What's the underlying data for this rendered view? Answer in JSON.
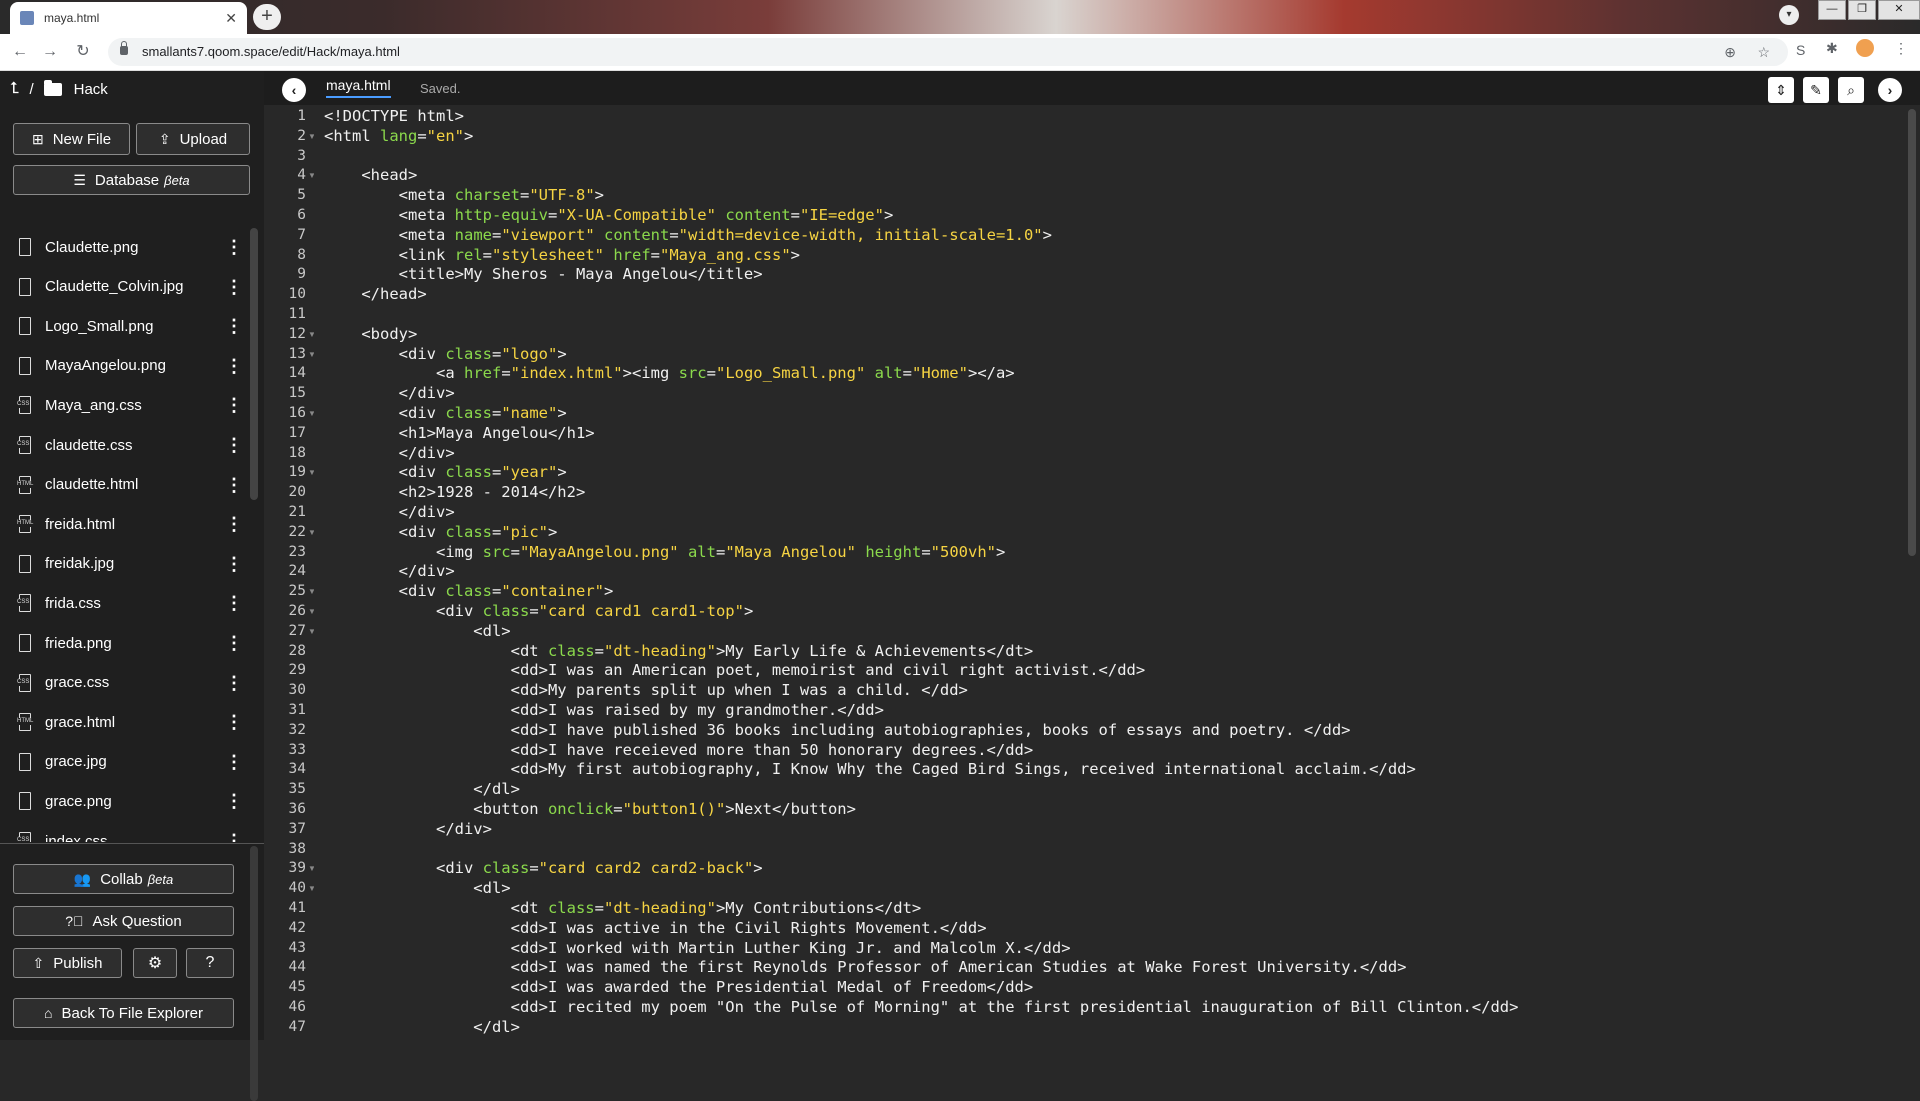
{
  "browser": {
    "tab_title": "maya.html",
    "url": "smallants7.qoom.space/edit/Hack/maya.html"
  },
  "sidebar": {
    "breadcrumb_folder": "Hack",
    "new_file_label": "New File",
    "upload_label": "Upload",
    "database_label": "Database",
    "database_beta": "βeta",
    "files": [
      {
        "name": "Claudette.png",
        "type": "file"
      },
      {
        "name": "Claudette_Colvin.jpg",
        "type": "file"
      },
      {
        "name": "Logo_Small.png",
        "type": "file"
      },
      {
        "name": "MayaAngelou.png",
        "type": "file"
      },
      {
        "name": "Maya_ang.css",
        "type": "css"
      },
      {
        "name": "claudette.css",
        "type": "css"
      },
      {
        "name": "claudette.html",
        "type": "html"
      },
      {
        "name": "freida.html",
        "type": "html"
      },
      {
        "name": "freidak.jpg",
        "type": "file"
      },
      {
        "name": "frida.css",
        "type": "css"
      },
      {
        "name": "frieda.png",
        "type": "file"
      },
      {
        "name": "grace.css",
        "type": "css"
      },
      {
        "name": "grace.html",
        "type": "html"
      },
      {
        "name": "grace.jpg",
        "type": "file"
      },
      {
        "name": "grace.png",
        "type": "file"
      },
      {
        "name": "index.css",
        "type": "css"
      }
    ],
    "collab_label": "Collab",
    "collab_beta": "βeta",
    "ask_label": "Ask Question",
    "publish_label": "Publish",
    "back_label": "Back To File Explorer"
  },
  "editor": {
    "tab_name": "maya.html",
    "status": "Saved.",
    "lines": [
      "<!DOCTYPE html>",
      "<html lang=\"en\">",
      "",
      "    <head>",
      "        <meta charset=\"UTF-8\">",
      "        <meta http-equiv=\"X-UA-Compatible\" content=\"IE=edge\">",
      "        <meta name=\"viewport\" content=\"width=device-width, initial-scale=1.0\">",
      "        <link rel=\"stylesheet\" href=\"Maya_ang.css\">",
      "        <title>My Sheros - Maya Angelou</title>",
      "    </head>",
      "",
      "    <body>",
      "        <div class=\"logo\">",
      "            <a href=\"index.html\"><img src=\"Logo_Small.png\" alt=\"Home\"></a>",
      "        </div>",
      "        <div class=\"name\">",
      "        <h1>Maya Angelou</h1>",
      "        </div>",
      "        <div class=\"year\">",
      "        <h2>1928 - 2014</h2>",
      "        </div>",
      "        <div class=\"pic\">",
      "            <img src=\"MayaAngelou.png\" alt=\"Maya Angelou\" height=\"500vh\">",
      "        </div>",
      "        <div class=\"container\">",
      "            <div class=\"card card1 card1-top\">",
      "                <dl>",
      "                    <dt class=\"dt-heading\">My Early Life & Achievements</dt>",
      "                    <dd>I was an American poet, memoirist and civil right activist.</dd>",
      "                    <dd>My parents split up when I was a child. </dd>",
      "                    <dd>I was raised by my grandmother.</dd>",
      "                    <dd>I have published 36 books including autobiographies, books of essays and poetry. </dd>",
      "                    <dd>I have receieved more than 50 honorary degrees.</dd>",
      "                    <dd>My first autobiography, I Know Why the Caged Bird Sings, received international acclaim.</dd>",
      "                </dl>",
      "                <button onclick=\"button1()\">Next</button>",
      "            </div>",
      "",
      "            <div class=\"card card2 card2-back\">",
      "                <dl>",
      "                    <dt class=\"dt-heading\">My Contributions</dt>",
      "                    <dd>I was active in the Civil Rights Movement.</dd>",
      "                    <dd>I worked with Martin Luther King Jr. and Malcolm X.</dd>",
      "                    <dd>I was named the first Reynolds Professor of American Studies at Wake Forest University.</dd>",
      "                    <dd>I was awarded the Presidential Medal of Freedom</dd>",
      "                    <dd>I recited my poem \"On the Pulse of Morning\" at the first presidential inauguration of Bill Clinton.</dd>",
      "                </dl>"
    ],
    "fold_lines": [
      2,
      4,
      12,
      13,
      16,
      19,
      22,
      25,
      26,
      27,
      39,
      40
    ]
  },
  "colors": {
    "attribute": "#8bd94c",
    "string": "#f6d443",
    "text": "#f0f0f0",
    "background": "#282828",
    "sidebar": "#1f1f1f"
  }
}
